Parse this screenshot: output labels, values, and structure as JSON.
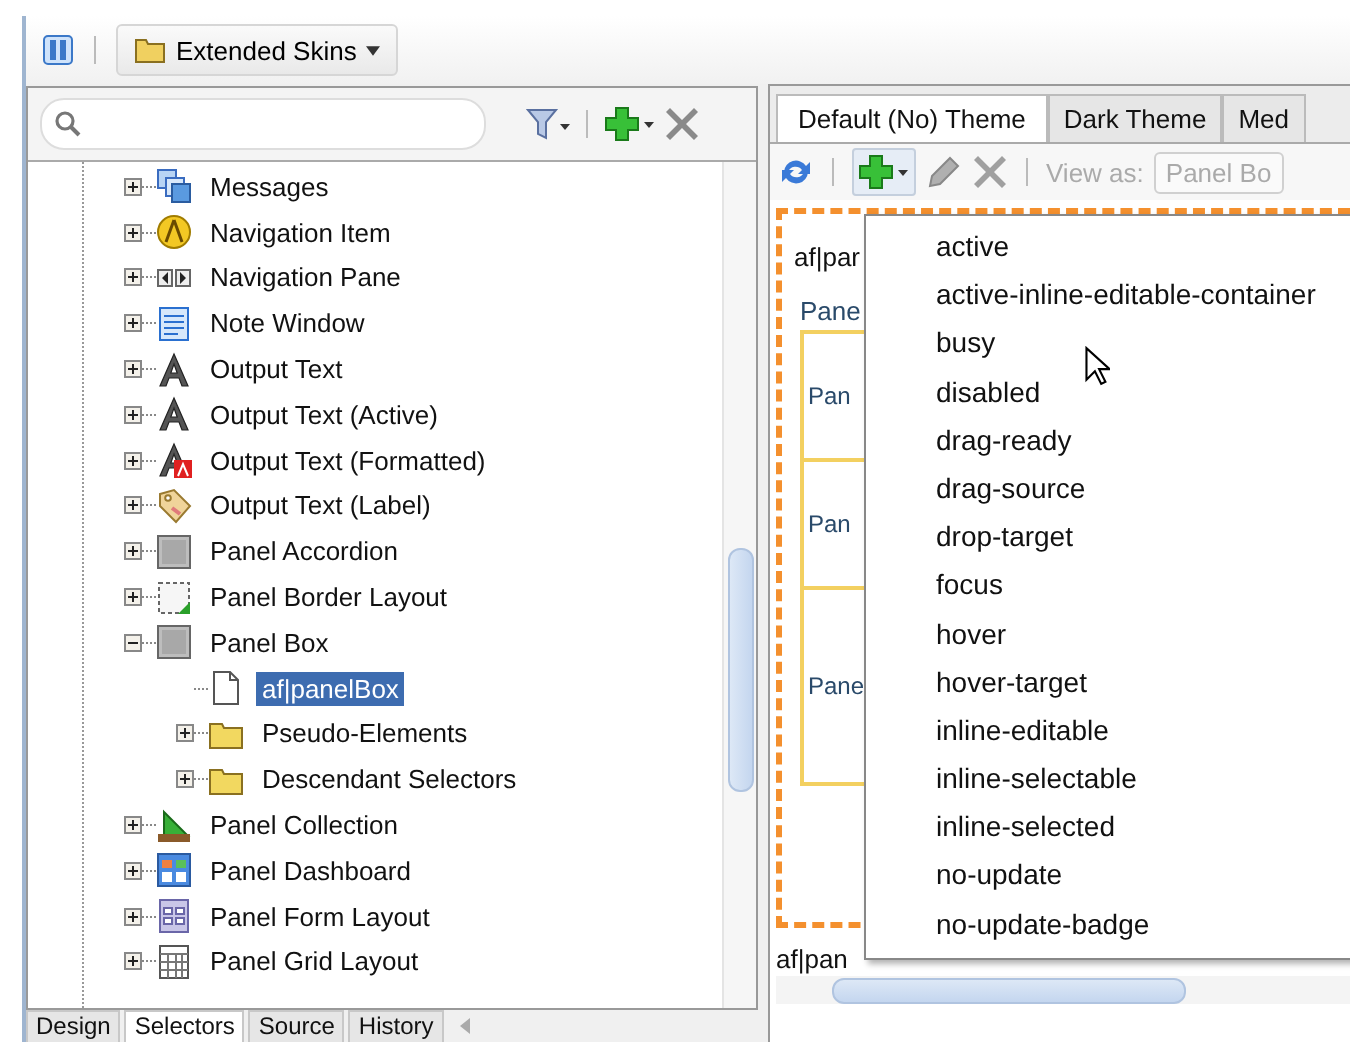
{
  "toolbar": {
    "skin_button": "Extended Skins"
  },
  "tree": [
    {
      "label": "Messages",
      "kind": "messages",
      "expanded": false,
      "selected": false
    },
    {
      "label": "Navigation Item",
      "kind": "compass",
      "expanded": false,
      "selected": false
    },
    {
      "label": "Navigation Pane",
      "kind": "arrows",
      "expanded": false,
      "selected": false
    },
    {
      "label": "Note Window",
      "kind": "note",
      "expanded": false,
      "selected": false
    },
    {
      "label": "Output Text",
      "kind": "letter",
      "expanded": false,
      "selected": false
    },
    {
      "label": "Output Text (Active)",
      "kind": "letter",
      "expanded": false,
      "selected": false
    },
    {
      "label": "Output Text (Formatted)",
      "kind": "badge",
      "expanded": false,
      "selected": false
    },
    {
      "label": "Output Text (Label)",
      "kind": "tag",
      "expanded": false,
      "selected": false
    },
    {
      "label": "Panel Accordion",
      "kind": "panel",
      "expanded": false,
      "selected": false
    },
    {
      "label": "Panel Border Layout",
      "kind": "dashed",
      "expanded": false,
      "selected": false
    },
    {
      "label": "Panel Box",
      "kind": "panel",
      "expanded": true,
      "selected": false,
      "children": [
        {
          "label": "af|panelBox",
          "kind": "page",
          "selected": true
        },
        {
          "label": "Pseudo-Elements",
          "kind": "folder",
          "expanded": false,
          "selected": false
        },
        {
          "label": "Descendant Selectors",
          "kind": "folder",
          "expanded": false,
          "selected": false
        }
      ]
    },
    {
      "label": "Panel Collection",
      "kind": "ruler",
      "expanded": false,
      "selected": false
    },
    {
      "label": "Panel Dashboard",
      "kind": "dashboard",
      "expanded": false,
      "selected": false
    },
    {
      "label": "Panel Form Layout",
      "kind": "form",
      "expanded": false,
      "selected": false
    },
    {
      "label": "Panel Grid Layout",
      "kind": "grid",
      "expanded": false,
      "selected": false
    }
  ],
  "bottom_tabs": [
    {
      "label": "Design",
      "selected": false
    },
    {
      "label": "Selectors",
      "selected": true
    },
    {
      "label": "Source",
      "selected": false
    },
    {
      "label": "History",
      "selected": false
    }
  ],
  "theme_tabs": [
    {
      "label": "Default (No) Theme",
      "selected": true
    },
    {
      "label": "Dark Theme",
      "selected": false
    },
    {
      "label": "Med",
      "selected": false
    }
  ],
  "editor_toolbar": {
    "view_as_label": "View as:",
    "view_as_value": "Panel Bo"
  },
  "preview": {
    "selector": "af|par",
    "panel_title": "Pane",
    "rows": [
      "Pan",
      "Pan",
      "Pane"
    ],
    "footer_selector": "af|pan"
  },
  "menu": [
    "active",
    "active-inline-editable-container",
    "busy",
    "disabled",
    "drag-ready",
    "drag-source",
    "drop-target",
    "focus",
    "hover",
    "hover-target",
    "inline-editable",
    "inline-selectable",
    "inline-selected",
    "no-update",
    "no-update-badge"
  ]
}
